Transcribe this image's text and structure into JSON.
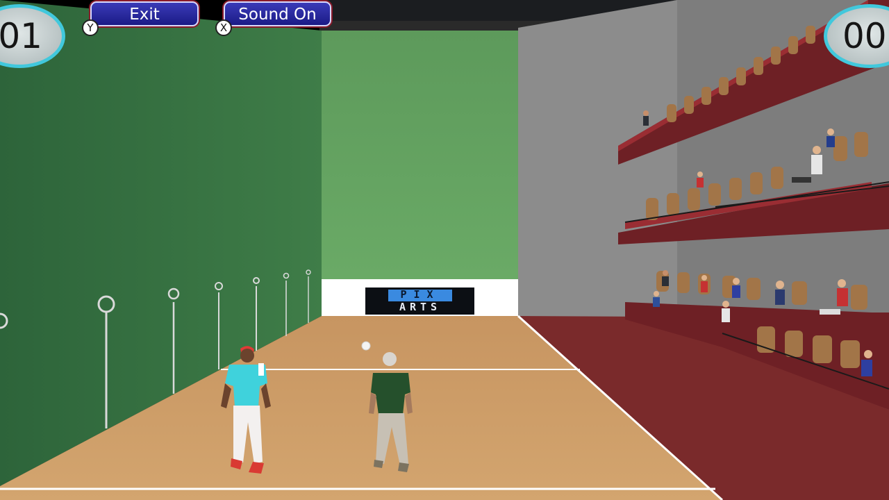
{
  "hud": {
    "exit_label": "Exit",
    "exit_key": "Y",
    "sound_label": "Sound On",
    "sound_key": "X",
    "score_left": "01",
    "score_right": "00"
  },
  "banner": {
    "line1": "PIX",
    "line2": "ARTS"
  },
  "colors": {
    "left_wall": "#2f6a3c",
    "front_wall": "#5e9c5c",
    "floor": "#c89a63",
    "side_floor": "#7b2a2a",
    "right_wall": "#8d8d8d",
    "button_fill": "#28289e",
    "score_ring": "#41c8dc",
    "player1_shirt": "#3fd2dc",
    "player2_shirt": "#25502c"
  }
}
